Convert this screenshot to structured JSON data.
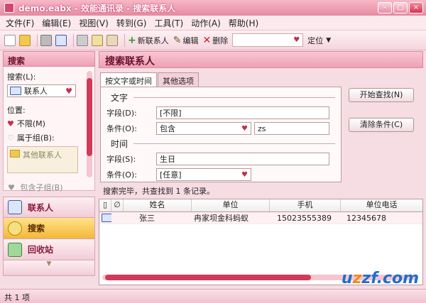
{
  "window": {
    "title": "demo.eabx - 效能通讯录 - 搜索联系人"
  },
  "menu": [
    "文件(F)",
    "编辑(E)",
    "视图(V)",
    "转到(G)",
    "工具(T)",
    "动作(A)",
    "帮助(H)"
  ],
  "toolbar": {
    "new_contact": "新联系人",
    "edit": "编辑",
    "delete": "删除",
    "search_value": "",
    "locate": "定位"
  },
  "left": {
    "title": "搜索",
    "search_label": "搜索(L):",
    "search_value": "联系人",
    "position_label": "位置:",
    "unlimited": "不限(M)",
    "belongs_group": "属于组(B):",
    "folder_item": "其他联系人",
    "include_subgroup": "包含子组(B)"
  },
  "nav": [
    {
      "label": "联系人"
    },
    {
      "label": "搜索"
    },
    {
      "label": "回收站"
    }
  ],
  "main": {
    "title": "搜索联系人",
    "tabs": [
      "按文字或时间",
      "其他选项"
    ],
    "text_section": "文字",
    "field_label": "字段(D):",
    "field_value": "[不限]",
    "condition_label": "条件(O):",
    "condition_value": "包含",
    "condition_text": "zs",
    "time_section": "时间",
    "time_field_label": "字段(S):",
    "time_field_value": "生日",
    "time_condition_label": "条件(O):",
    "time_condition_value": "[任意]",
    "start_button": "开始查找(N)",
    "clear_button": "清除条件(C)",
    "result_text": "搜索完毕，共查找到 1 条记录。"
  },
  "grid": {
    "columns": [
      "姓名",
      "单位",
      "手机",
      "单位电话"
    ],
    "rows": [
      {
        "name": "张三",
        "company": "冉家坝金科蚂蚁",
        "mobile": "15023555389",
        "phone": "12345678"
      }
    ]
  },
  "status": {
    "text": "共 1 项"
  },
  "brand": {
    "left": "u",
    "z": "z",
    "right": "zf.com"
  },
  "colors": {
    "accent": "#d23a5a",
    "header": "#eea1b5"
  }
}
